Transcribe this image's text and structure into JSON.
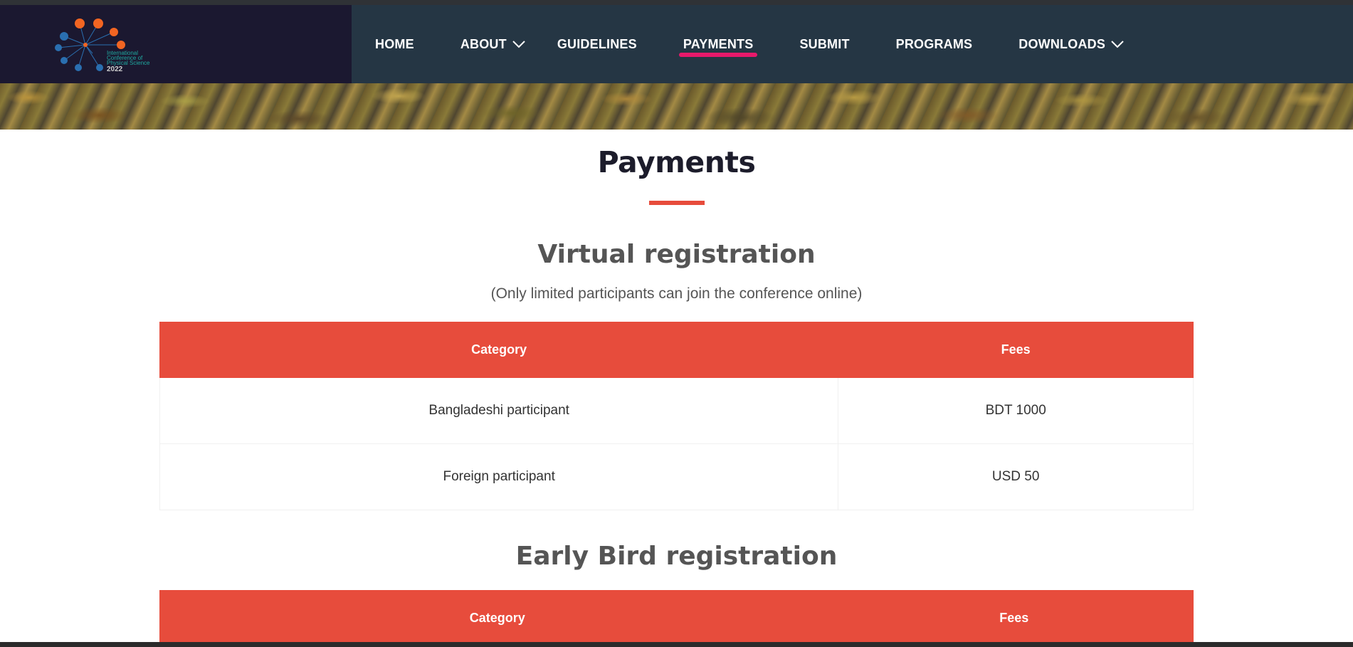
{
  "header": {
    "logo": {
      "line1": "International",
      "line2": "Conference of",
      "line3": "Physical Science",
      "year": "2022"
    },
    "nav": [
      {
        "label": "HOME",
        "has_dropdown": false,
        "active": false
      },
      {
        "label": "ABOUT",
        "has_dropdown": true,
        "active": false
      },
      {
        "label": "GUIDELINES",
        "has_dropdown": false,
        "active": false
      },
      {
        "label": "PAYMENTS",
        "has_dropdown": false,
        "active": true
      },
      {
        "label": "SUBMIT",
        "has_dropdown": false,
        "active": false
      },
      {
        "label": "PROGRAMS",
        "has_dropdown": false,
        "active": false
      },
      {
        "label": "DOWNLOADS",
        "has_dropdown": true,
        "active": false
      }
    ]
  },
  "page": {
    "title": "Payments"
  },
  "sections": [
    {
      "title": "Virtual registration",
      "subtitle": "(Only limited participants can join the conference online)",
      "table": {
        "headers": [
          "Category",
          "Fees"
        ],
        "rows": [
          [
            "Bangladeshi participant",
            "BDT 1000"
          ],
          [
            "Foreign participant",
            "USD 50"
          ]
        ]
      }
    },
    {
      "title": "Early Bird registration",
      "table": {
        "headers": [
          "Category",
          "Fees"
        ]
      }
    }
  ],
  "colors": {
    "header_bg": "#253644",
    "logo_bg": "#1b1830",
    "accent": "#e74c3c",
    "nav_active_underline": "#e8196b"
  }
}
